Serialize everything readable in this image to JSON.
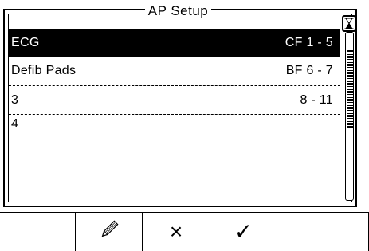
{
  "window": {
    "title": "AP Setup"
  },
  "list": {
    "items": [
      {
        "label": "ECG",
        "value": "CF 1 - 5",
        "selected": true
      },
      {
        "label": "Defib Pads",
        "value": "BF 6 - 7",
        "selected": false
      },
      {
        "label": "3",
        "value": "8 - 11",
        "selected": false
      },
      {
        "label": "4",
        "value": "",
        "selected": false
      },
      {
        "label": "",
        "value": "",
        "selected": false
      }
    ]
  },
  "status": {
    "busy_icon": "hourglass-icon"
  },
  "softkeys": {
    "keys": [
      {
        "id": "blank-left",
        "icon": "",
        "glyph": ""
      },
      {
        "id": "edit",
        "icon": "pencil-icon",
        "glyph": ""
      },
      {
        "id": "cancel",
        "icon": "cross-icon",
        "glyph": "×"
      },
      {
        "id": "confirm",
        "icon": "check-icon",
        "glyph": "✓"
      },
      {
        "id": "blank-right",
        "icon": "",
        "glyph": ""
      }
    ]
  },
  "colors": {
    "background": "#ffffff",
    "foreground": "#000000",
    "selection": "#000000"
  }
}
